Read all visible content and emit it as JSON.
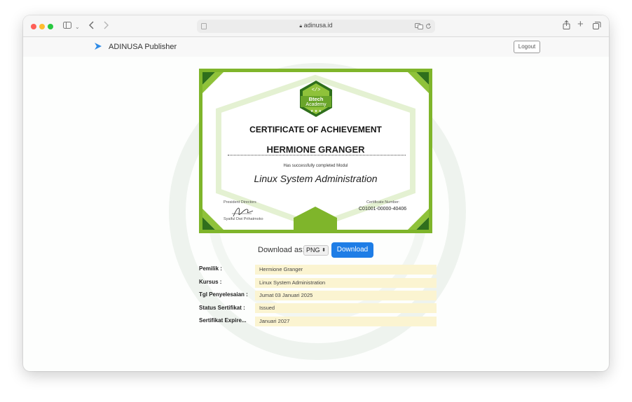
{
  "browser": {
    "url": "adinusa.id"
  },
  "header": {
    "brand": "ADINUSA Publisher",
    "logout_label": "Logout"
  },
  "certificate": {
    "badge_line1": "Btech",
    "badge_line2": "Academy",
    "title": "CERTIFICATE OF ACHIEVEMENT",
    "recipient": "HERMIONE GRANGER",
    "subtitle": "Has successfully completed Modul",
    "course": "Linux System Administration",
    "signer_role": "President Directors",
    "signer_name": "Syaiful Dwi Prihatmoko",
    "number_label": "Certificate Number:",
    "number": "C01001-00000-40406"
  },
  "download": {
    "label": "Download as:",
    "format": "PNG",
    "button_label": "Download"
  },
  "details": [
    {
      "label": "Pemilik :",
      "value": "Hermione Granger"
    },
    {
      "label": "Kursus :",
      "value": "Linux System Administration"
    },
    {
      "label": "Tgl Penyelesaian :",
      "value": "Jumat 03 Januari 2025"
    },
    {
      "label": "Status Sertifikat :",
      "value": "Issued"
    },
    {
      "label": "Sertifikat Expire...",
      "value": "Januari 2027"
    }
  ],
  "colors": {
    "cert_green": "#7fb52b",
    "cert_dark_green": "#2f6f1c",
    "download_blue": "#1e7de6",
    "value_bg": "#fbf4d1"
  }
}
